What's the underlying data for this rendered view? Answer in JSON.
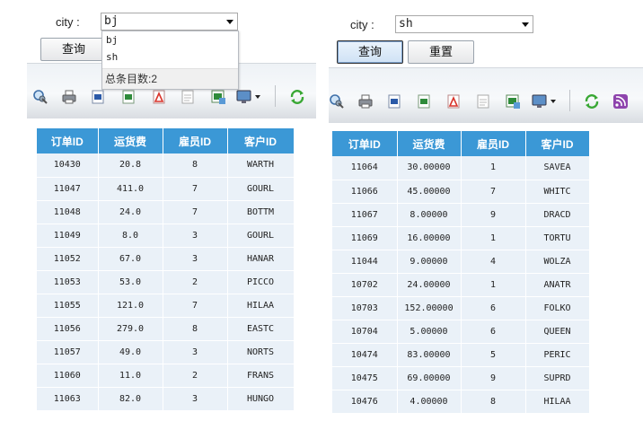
{
  "left": {
    "city_label": "city :",
    "city_value": "bj",
    "query_label": "查询",
    "dropdown": {
      "options": [
        "bj",
        "sh"
      ],
      "total_text": "总条目数:2"
    },
    "table": {
      "headers": [
        "订单ID",
        "运货费",
        "雇员ID",
        "客户ID"
      ],
      "rows": [
        [
          "10430",
          "20.8",
          "8",
          "WARTH"
        ],
        [
          "11047",
          "411.0",
          "7",
          "GOURL"
        ],
        [
          "11048",
          "24.0",
          "7",
          "BOTTM"
        ],
        [
          "11049",
          "8.0",
          "3",
          "GOURL"
        ],
        [
          "11052",
          "67.0",
          "3",
          "HANAR"
        ],
        [
          "11053",
          "53.0",
          "2",
          "PICCO"
        ],
        [
          "11055",
          "121.0",
          "7",
          "HILAA"
        ],
        [
          "11056",
          "279.0",
          "8",
          "EASTC"
        ],
        [
          "11057",
          "49.0",
          "3",
          "NORTS"
        ],
        [
          "11060",
          "11.0",
          "2",
          "FRANS"
        ],
        [
          "11063",
          "82.0",
          "3",
          "HUNGO"
        ]
      ]
    }
  },
  "right": {
    "city_label": "city :",
    "city_value": "sh",
    "query_label": "查询",
    "reset_label": "重置",
    "table": {
      "headers": [
        "订单ID",
        "运货费",
        "雇员ID",
        "客户ID"
      ],
      "rows": [
        [
          "11064",
          "30.00000",
          "1",
          "SAVEA"
        ],
        [
          "11066",
          "45.00000",
          "7",
          "WHITC"
        ],
        [
          "11067",
          "8.00000",
          "9",
          "DRACD"
        ],
        [
          "11069",
          "16.00000",
          "1",
          "TORTU"
        ],
        [
          "11044",
          "9.00000",
          "4",
          "WOLZA"
        ],
        [
          "10702",
          "24.00000",
          "1",
          "ANATR"
        ],
        [
          "10703",
          "152.00000",
          "6",
          "FOLKO"
        ],
        [
          "10704",
          "5.00000",
          "6",
          "QUEEN"
        ],
        [
          "10474",
          "83.00000",
          "5",
          "PERIC"
        ],
        [
          "10475",
          "69.00000",
          "9",
          "SUPRD"
        ],
        [
          "10476",
          "4.00000",
          "8",
          "HILAA"
        ]
      ]
    }
  },
  "toolbar_icons_left": [
    "zoom-icon",
    "print-icon",
    "word-export-icon",
    "excel-export-icon",
    "pdf-export-icon",
    "text-export-icon",
    "excel-image-export-icon",
    "screen-menu-icon",
    "refresh-icon"
  ],
  "toolbar_icons_right": [
    "zoom-icon",
    "print-icon",
    "word-export-icon",
    "excel-export-icon",
    "pdf-export-icon",
    "text-export-icon",
    "excel-image-export-icon",
    "screen-menu-icon",
    "refresh-icon",
    "rss-icon"
  ],
  "colors": {
    "header_bg": "#3b98d6",
    "row_bg": "#eaf1f8",
    "refresh_green": "#3aa835",
    "pdf_red": "#d9342b",
    "excel_green": "#2e8b3a",
    "word_blue": "#2b5aa8",
    "rss_purple": "#8e44ad"
  }
}
